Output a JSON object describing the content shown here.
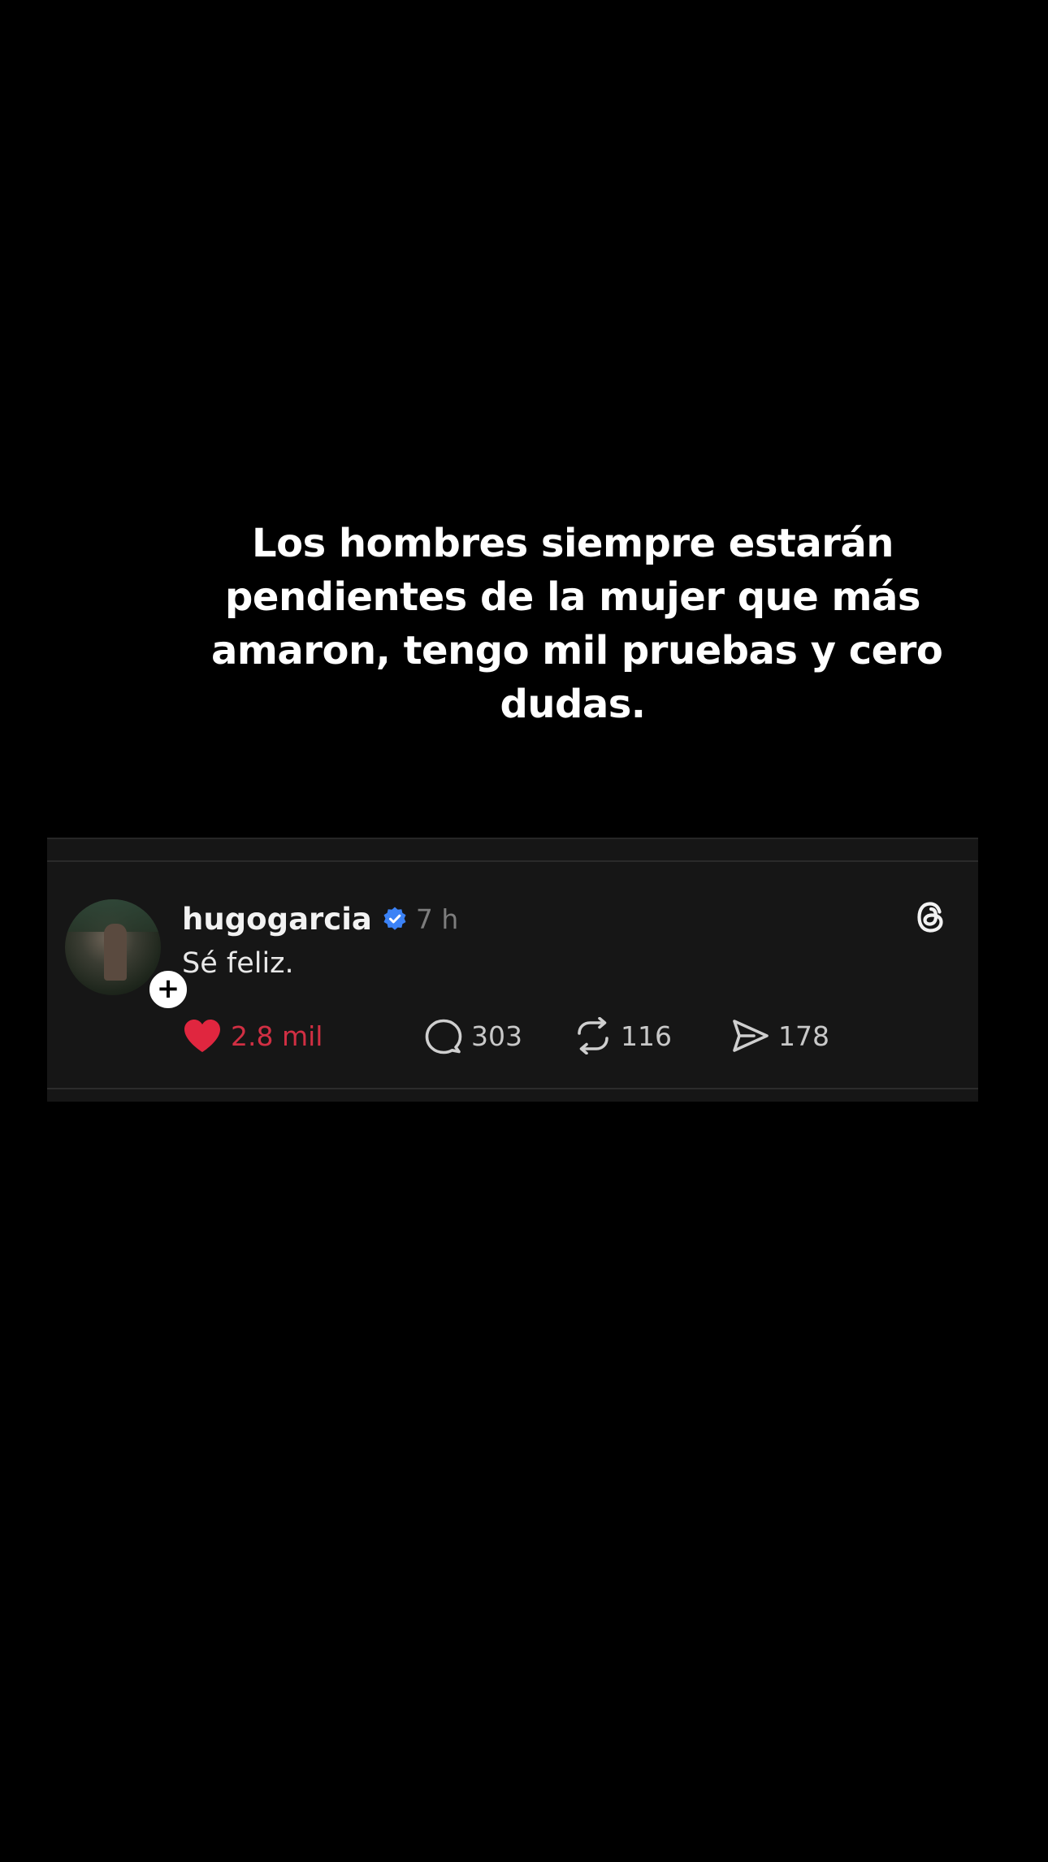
{
  "caption": {
    "lines": [
      "Los hombres siempre estarán",
      "pendientes de la mujer que más",
      "amaron, tengo mil pruebas y cero",
      "dudas."
    ]
  },
  "post": {
    "username": "hugogarcia",
    "verified_icon": "verified-badge-icon",
    "time": "7 h",
    "text": "Sé feliz.",
    "follow_symbol": "+",
    "app_icon": "threads-logo-icon",
    "actions": {
      "likes": "2.8 mil",
      "replies": "303",
      "reposts": "116",
      "shares": "178"
    }
  },
  "colors": {
    "background": "#000000",
    "card": "#161616",
    "like": "#d12f43",
    "verified": "#3b82f6",
    "muted_text": "#7d7d7d"
  }
}
